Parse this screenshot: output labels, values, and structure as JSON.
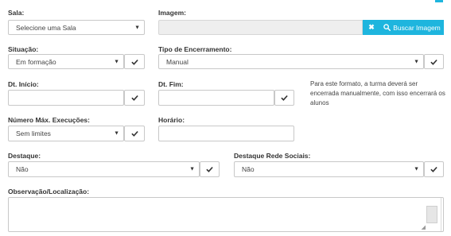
{
  "sala": {
    "label": "Sala:",
    "value": "Selecione uma Sala"
  },
  "imagem": {
    "label": "Imagem:",
    "clear_label": "✖",
    "search_label": "Buscar Imagem"
  },
  "situacao": {
    "label": "Situação:",
    "value": "Em formação"
  },
  "tipo_encerramento": {
    "label": "Tipo de Encerramento:",
    "value": "Manual"
  },
  "dt_inicio": {
    "label": "Dt. Início:",
    "value": ""
  },
  "dt_fim": {
    "label": "Dt. Fim:",
    "value": ""
  },
  "note": "Para este formato, a turma deverá ser encerrada manualmente, com isso encerrará os alunos",
  "num_execucoes": {
    "label": "Número Máx. Execuções:",
    "value": "Sem limites"
  },
  "horario": {
    "label": "Horário:",
    "value": ""
  },
  "destaque": {
    "label": "Destaque:",
    "value": "Não"
  },
  "destaque_redes": {
    "label": "Destaque Rede Sociais:",
    "value": "Não"
  },
  "observacao": {
    "label": "Observação/Localização:",
    "value": ""
  },
  "colors": {
    "accent": "#1eb5de",
    "border": "#c8c8c8",
    "disabled": "#eeeeee"
  },
  "icons": {
    "check": "check-icon",
    "caret": "caret-down-icon",
    "search": "search-icon",
    "clear": "times-icon"
  }
}
